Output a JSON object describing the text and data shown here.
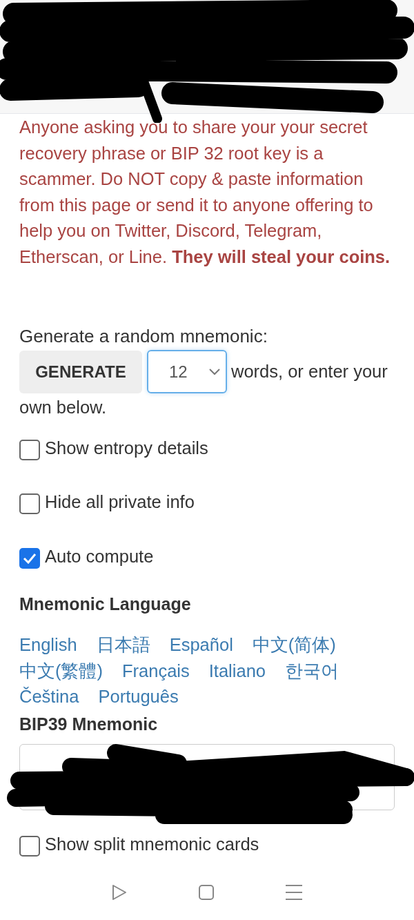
{
  "warning": {
    "text": "Anyone asking you to share your your secret recovery phrase or BIP 32 root key is a scammer. Do NOT copy & paste information from this page or send it to anyone offering to help you on Twitter, Discord, Telegram, Etherscan, or Line. **They will steal your coins.**"
  },
  "generate": {
    "prompt": "Generate a random mnemonic:",
    "button": "GENERATE",
    "word_count": "12",
    "suffix": [
      "words, or enter your",
      "own below."
    ]
  },
  "options": [
    {
      "label": "Show entropy details",
      "checked": false
    },
    {
      "label": "Hide all private info",
      "checked": false
    },
    {
      "label": "Auto compute",
      "checked": true
    }
  ],
  "language": {
    "heading": "Mnemonic Language",
    "languages": [
      "English",
      "日本語",
      "Español",
      "中文(简体)",
      "中文(繁體)",
      "Français",
      "Italiano",
      "한국어",
      "Čeština",
      "Português"
    ]
  },
  "mnemonic": {
    "heading": "BIP39 Mnemonic"
  },
  "split_cards": {
    "label": "Show split mnemonic cards",
    "checked": false
  }
}
